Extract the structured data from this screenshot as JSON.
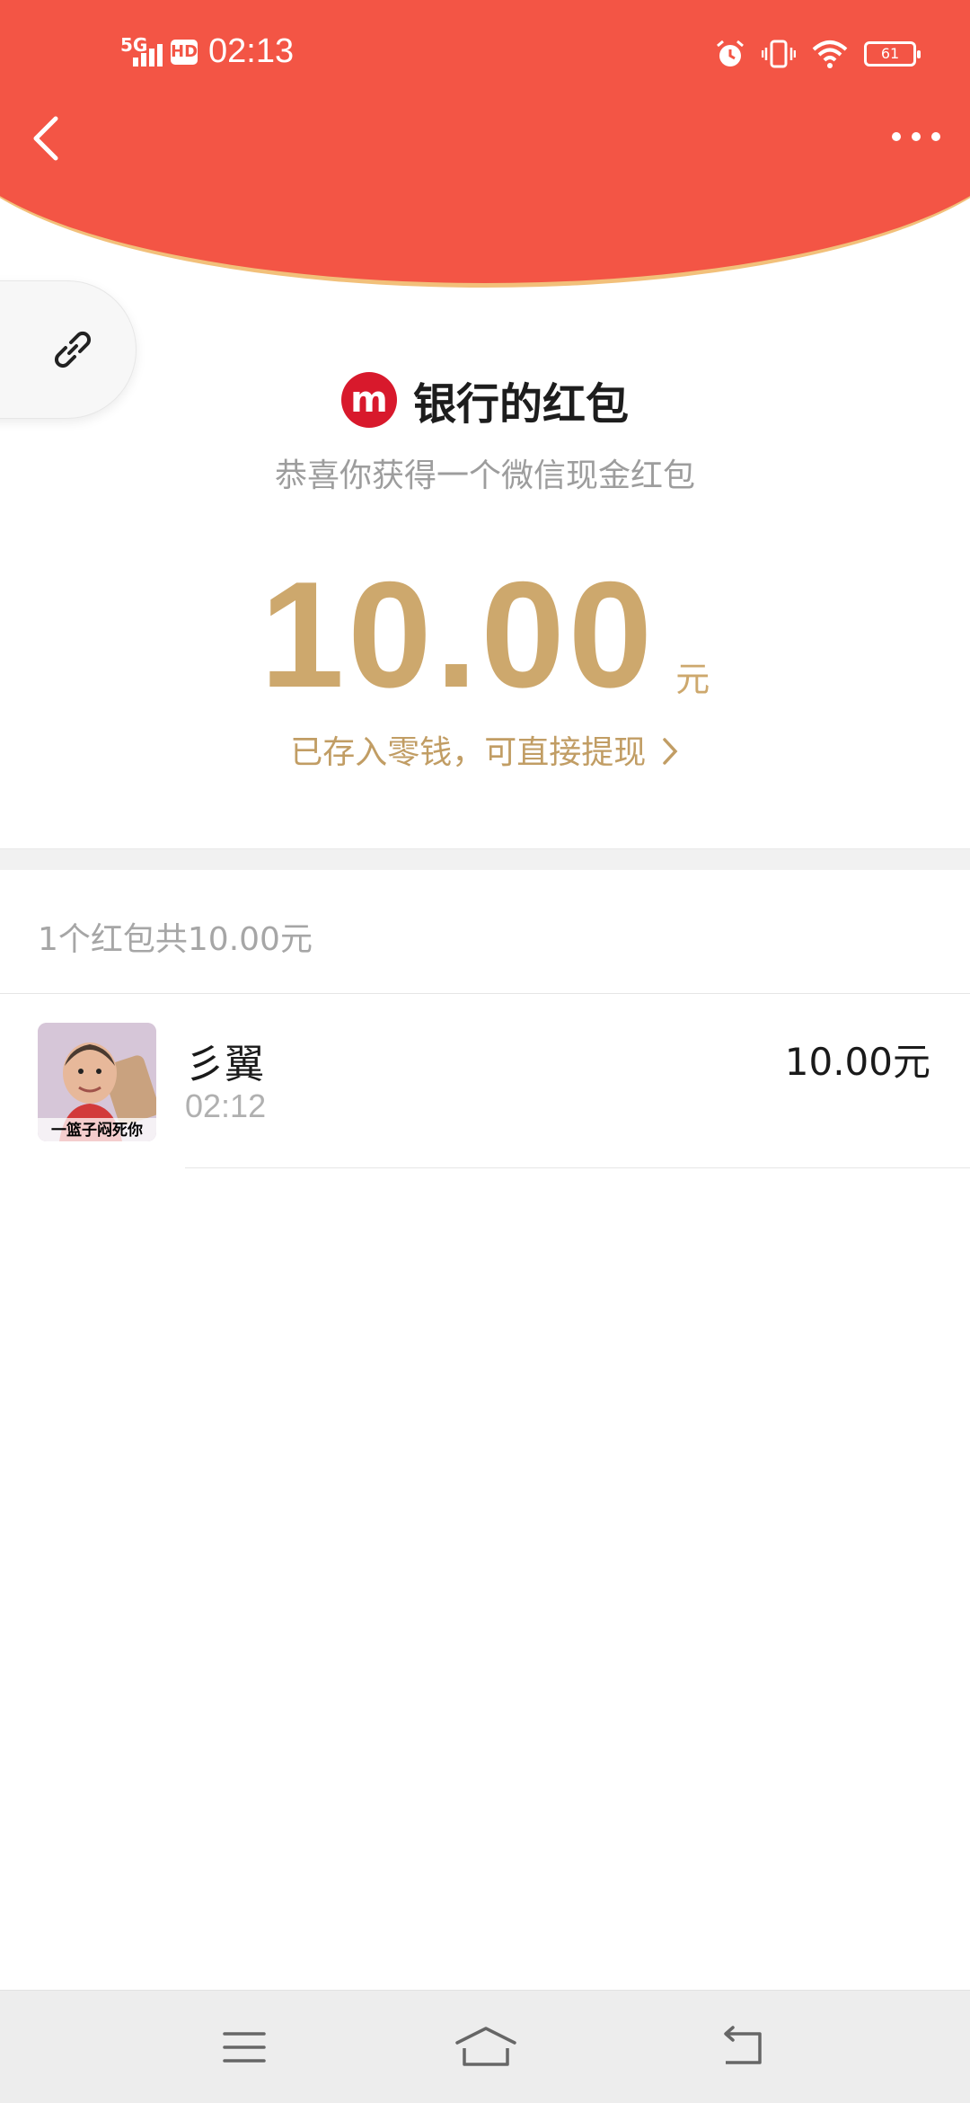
{
  "status_bar": {
    "network": "5G",
    "hd": "HD",
    "time": "02:13",
    "battery": "61"
  },
  "header": {
    "back_icon": "chevron-left-icon",
    "more_icon": "more-dots-icon",
    "background_color": "#f35545"
  },
  "float_button": {
    "icon": "link-icon"
  },
  "packet": {
    "logo_letter": "m",
    "title": "银行的红包",
    "subtitle": "恭喜你获得一个微信现金红包",
    "amount": "10.00",
    "unit": "元",
    "saved_link": "已存入零钱，可直接提现",
    "accent_color": "#cda86d"
  },
  "summary": "1个红包共10.00元",
  "records": [
    {
      "avatar_caption": "一篮子闷死你",
      "name": "彡翼",
      "time": "02:12",
      "amount": "10.00元"
    }
  ],
  "bottom_nav": {
    "menu_icon": "menu-icon",
    "home_icon": "home-icon",
    "back_icon": "return-icon"
  }
}
